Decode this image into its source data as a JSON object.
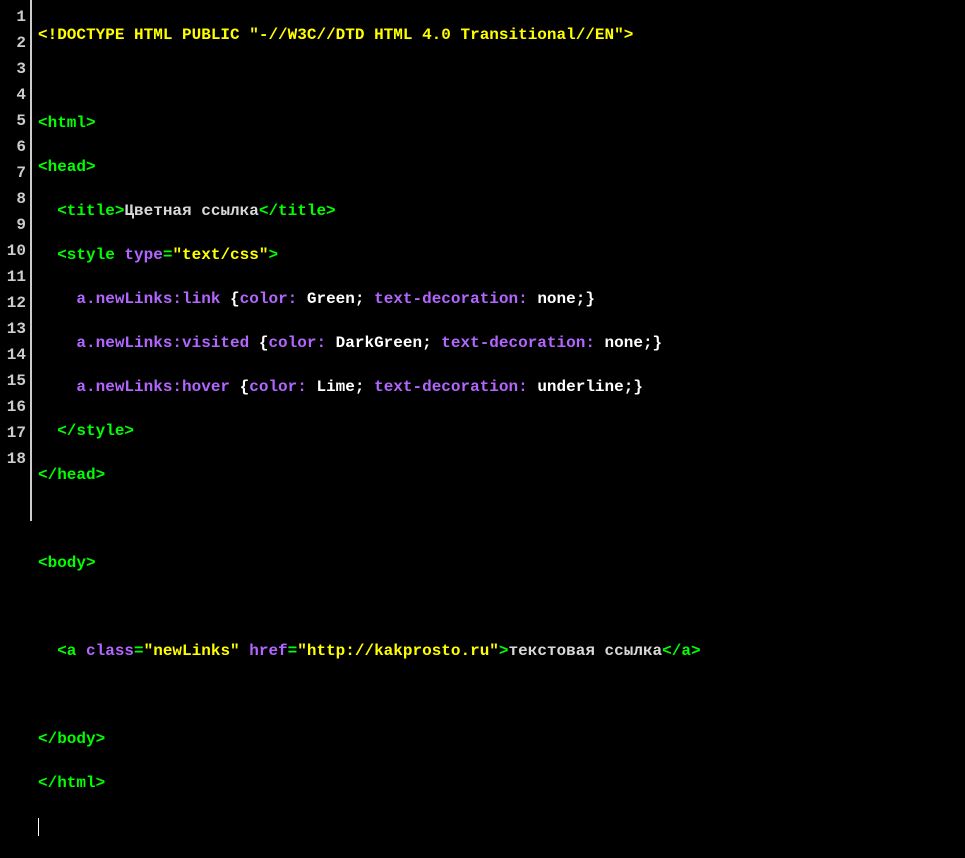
{
  "lineNumbers": [
    "1",
    "2",
    "3",
    "4",
    "5",
    "6",
    "7",
    "8",
    "9",
    "10",
    "11",
    "12",
    "13",
    "14",
    "15",
    "16",
    "17",
    "18"
  ],
  "code": {
    "l1": {
      "doctype_open": "<!",
      "doctype_name": "DOCTYPE HTML PUBLIC",
      "space": " ",
      "dtd": "\"-//W3C//DTD HTML 4.0 Transitional//EN\"",
      "close": ">"
    },
    "l2": "",
    "l3": {
      "open": "<html>",
      "text": ""
    },
    "l4": {
      "open": "<head>"
    },
    "l5": {
      "indent": "  ",
      "open": "<title>",
      "text": "Цветная ссылка",
      "close": "</title>"
    },
    "l6": {
      "indent": "  ",
      "open_start": "<style",
      "attr": " type",
      "eq": "=",
      "val": "\"text/css\"",
      "open_end": ">"
    },
    "l7": {
      "indent": "    ",
      "sel": "a.newLinks:link",
      "space": " ",
      "brace_open": "{",
      "prop1": "color:",
      "val1": " Green",
      "semi1": ";",
      "prop2": " text-decoration:",
      "val2": " none",
      "semi2": ";",
      "brace_close": "}"
    },
    "l8": {
      "indent": "    ",
      "sel": "a.newLinks:visited",
      "space": " ",
      "brace_open": "{",
      "prop1": "color:",
      "val1": " DarkGreen",
      "semi1": ";",
      "prop2": " text-decoration:",
      "val2": " none",
      "semi2": ";",
      "brace_close": "}"
    },
    "l9": {
      "indent": "    ",
      "sel": "a.newLinks:hover",
      "space": " ",
      "brace_open": "{",
      "prop1": "color:",
      "val1": " Lime",
      "semi1": ";",
      "prop2": " text-decoration:",
      "val2": " underline",
      "semi2": ";",
      "brace_close": "}"
    },
    "l10": {
      "indent": "  ",
      "close": "</style>"
    },
    "l11": {
      "close": "</head>"
    },
    "l12": "",
    "l13": {
      "open": "<body>"
    },
    "l14": "",
    "l15": {
      "indent": "  ",
      "open_start": "<a",
      "attr1": " class",
      "eq1": "=",
      "val1": "\"newLinks\"",
      "attr2": " href",
      "eq2": "=",
      "val2": "\"http://kakprosto.ru\"",
      "open_end": ">",
      "text": "текстовая ссылка",
      "close": "</a>"
    },
    "l16": "",
    "l17": {
      "close": "</body>"
    },
    "l18": {
      "close": "</html>"
    }
  }
}
